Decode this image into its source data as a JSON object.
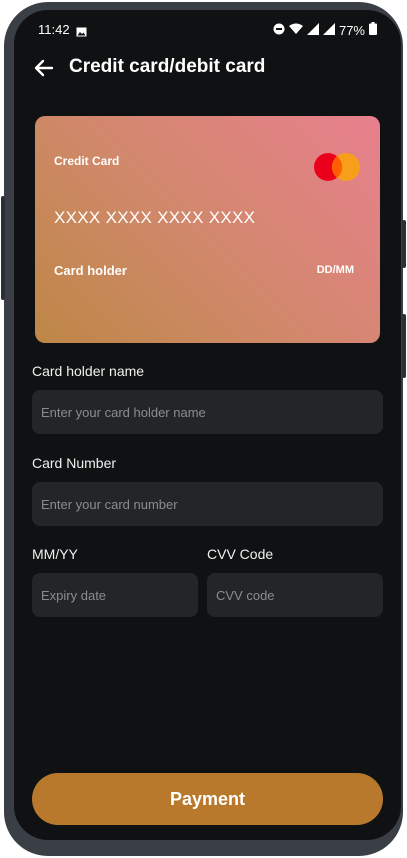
{
  "status_bar": {
    "time": "11:42",
    "battery": "77%",
    "icons": [
      "photo-icon",
      "dnd-icon",
      "wifi-icon",
      "signal-icon",
      "battery-icon"
    ]
  },
  "app_bar": {
    "title": "Credit card/debit card",
    "back_icon": "arrow-left-icon"
  },
  "card": {
    "type_label": "Credit Card",
    "number": "XXXX XXXX XXXX XXXX",
    "holder_label": "Card holder",
    "expiry_label": "DD/MM",
    "brand_icon": "mastercard-logo",
    "gradient_colors": [
      "#be8746",
      "#e8808e"
    ]
  },
  "form": {
    "holder_name": {
      "label": "Card holder name",
      "placeholder": "Enter your card holder name",
      "value": ""
    },
    "card_number": {
      "label": "Card Number",
      "placeholder": "Enter your card number",
      "value": ""
    },
    "expiry": {
      "label": "MM/YY",
      "placeholder": "Expiry date",
      "value": ""
    },
    "cvv": {
      "label": "CVV Code",
      "placeholder": "CVV code",
      "value": ""
    }
  },
  "actions": {
    "pay_label": "Payment"
  },
  "colors": {
    "background": "#0f1112",
    "input_bg": "#232526",
    "accent": "#b9792d"
  }
}
